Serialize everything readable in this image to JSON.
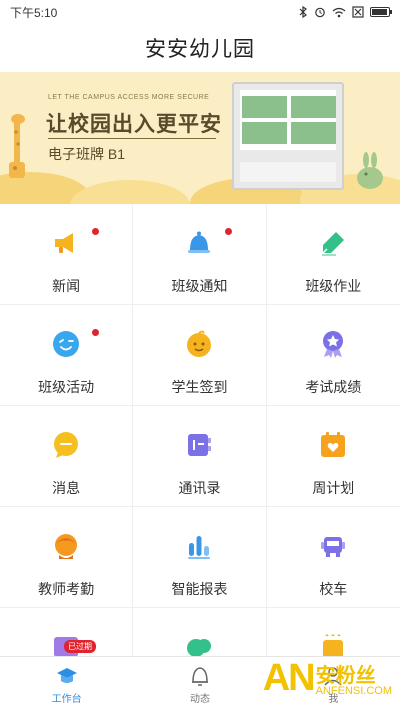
{
  "status_bar": {
    "time": "下午5:10",
    "icons": [
      "bluetooth-icon",
      "alarm-icon",
      "wifi-icon",
      "sim-off-icon",
      "battery-icon"
    ],
    "battery_level": 0.95
  },
  "header": {
    "title": "安安幼儿园"
  },
  "banner": {
    "subtitle": "LET THE CAMPUS ACCESS MORE SECURE",
    "title": "让校园出入更平安",
    "product": "电子班牌 B1"
  },
  "grid": {
    "items": [
      {
        "label": "新闻",
        "icon": "megaphone-icon",
        "color": "#f5b41f",
        "dot": true
      },
      {
        "label": "班级通知",
        "icon": "bell-icon",
        "color": "#3b97e6",
        "dot": true
      },
      {
        "label": "班级作业",
        "icon": "pen-icon",
        "color": "#33c189",
        "dot": false
      },
      {
        "label": "班级活动",
        "icon": "wink-face-icon",
        "color": "#39a7ee",
        "dot": true
      },
      {
        "label": "学生签到",
        "icon": "child-face-icon",
        "color": "#f5b41f",
        "dot": false
      },
      {
        "label": "考试成绩",
        "icon": "medal-icon",
        "color": "#7b70e5",
        "dot": false
      },
      {
        "label": "消息",
        "icon": "chat-bubble-icon",
        "color": "#f5c01f",
        "dot": false
      },
      {
        "label": "通讯录",
        "icon": "contacts-icon",
        "color": "#7b70e5",
        "dot": false
      },
      {
        "label": "周计划",
        "icon": "calendar-heart-icon",
        "color": "#f5a21f",
        "dot": false
      },
      {
        "label": "教师考勤",
        "icon": "teacher-icon",
        "color": "#f59a1f",
        "dot": false
      },
      {
        "label": "智能报表",
        "icon": "bar-chart-icon",
        "color": "#3b97e6",
        "dot": false
      },
      {
        "label": "校车",
        "icon": "bus-icon",
        "color": "#7b70e5",
        "dot": false
      },
      {
        "label": "",
        "icon": "card-icon",
        "color": "#a07ae5",
        "dot": false,
        "badge": "已过期"
      },
      {
        "label": "",
        "icon": "cloud-icon",
        "color": "#33c189",
        "dot": false
      },
      {
        "label": "",
        "icon": "cup-icon",
        "color": "#f5b41f",
        "dot": false
      }
    ]
  },
  "bottom_nav": {
    "items": [
      {
        "label": "工作台",
        "icon": "graduation-cap-icon",
        "active": true
      },
      {
        "label": "动态",
        "icon": "bell-outline-icon",
        "active": false
      },
      {
        "label": "我",
        "icon": "person-outline-icon",
        "active": false
      }
    ]
  },
  "watermark": {
    "big": "AN",
    "cn": "安粉丝",
    "en": "ANFENSI.COM"
  },
  "colors": {
    "accent": "#2b8fe3",
    "badge": "#e0242f",
    "banner_bg": "#fbeec4"
  }
}
